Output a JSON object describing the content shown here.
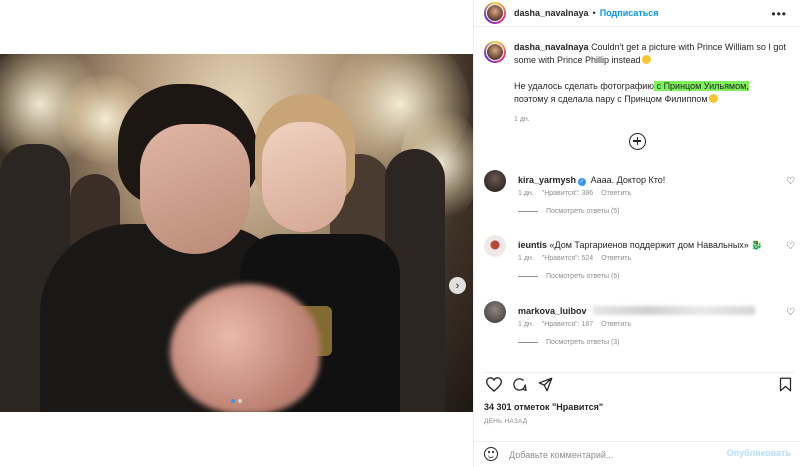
{
  "post": {
    "username": "dasha_navalnaya",
    "separator": "•",
    "follow_label": "Подписаться",
    "more_icon": "more-horizontal-icon"
  },
  "caption": {
    "username": "dasha_navalnaya",
    "text_en": "Couldn't get a picture with Prince William so I got some with Prince Phillip instead",
    "text_ru_before": "Не удалось сделать фотографию",
    "text_ru_highlight": " с Принцом Уильямом,",
    "text_ru_after": "поэтому я сделала пару с Принцом Филиппом",
    "time": "1 дн."
  },
  "comments": [
    {
      "username": "kira_yarmysh",
      "verified": true,
      "text": "Аааа. Доктор Кто!",
      "time": "1 дн.",
      "likes_label": "\"Нравится\": 386",
      "reply_label": "Ответить",
      "view_replies": "Посмотреть ответы (5)"
    },
    {
      "username": "ieuntis",
      "verified": false,
      "text": "«Дом Таргариенов поддержит дом Навальных»",
      "time": "1 дн.",
      "likes_label": "\"Нравится\": 524",
      "reply_label": "Ответить",
      "view_replies": "Посмотреть ответы (6)"
    },
    {
      "username": "markova_luibov",
      "verified": false,
      "text": "",
      "time": "1 дн.",
      "likes_label": "\"Нравится\": 187",
      "reply_label": "Ответить",
      "view_replies": "Посмотреть ответы (3)"
    }
  ],
  "stats": {
    "likes_text": "34 301 отметок \"Нравится\"",
    "date_text": "ДЕНЬ НАЗАД"
  },
  "comment_box": {
    "placeholder": "Добавьте комментарий...",
    "post_label": "Опубликовать"
  },
  "carousel": {
    "next_label": "›",
    "current_slide": 1,
    "total_slides": 2
  },
  "icons": {
    "heart": "heart-icon",
    "comment": "comment-icon",
    "share": "share-icon",
    "save": "bookmark-icon",
    "emoji": "emoji-icon",
    "load_more": "plus-circle-icon"
  },
  "colors": {
    "link_blue": "#0095f6",
    "highlight_green": "#7ef05a",
    "muted_text": "#8e8e8e"
  }
}
